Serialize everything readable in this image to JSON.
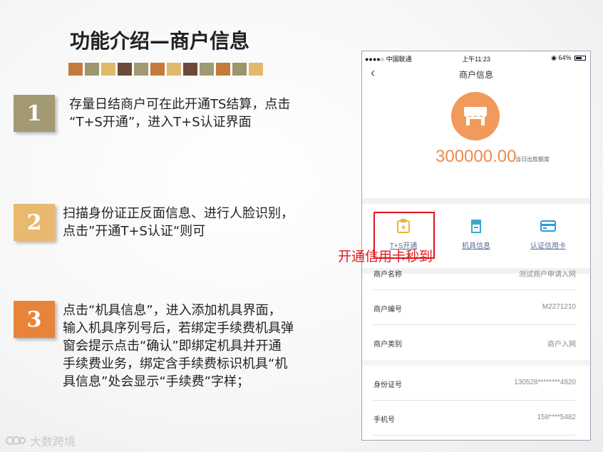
{
  "slide": {
    "title": "功能介绍—商户信息",
    "swatch_colors": [
      "#c47a3a",
      "#9c9570",
      "#e0b96d",
      "#6b4a3a",
      "#a09a72",
      "#c47a3a",
      "#e0b96d",
      "#6b4a3a",
      "#a09a72",
      "#c47a3a",
      "#9c9570",
      "#e0b96d"
    ]
  },
  "steps": [
    {
      "number": "1",
      "color": "#a39a74",
      "lines": [
        "存量日结商户可在此开通TS结算，点击",
        "“T+S开通”，进入T+S认证界面"
      ]
    },
    {
      "number": "2",
      "color": "#e8b96e",
      "lines": [
        "扫描身份证正反面信息、进行人脸识别，",
        "点击”开通T+S认证“则可"
      ]
    },
    {
      "number": "3",
      "color": "#e8843a",
      "lines": [
        "点击“机具信息”，进入添加机具界面，",
        "输入机具序列号后，若绑定手续费机具弹",
        "窗会提示点击“确认”即绑定机具并开通",
        "手续费业务，绑定含手续费标识机具“机",
        "具信息”处会显示“手续费”字样；"
      ]
    }
  ],
  "phone": {
    "status": {
      "carrier": "●●●●○ 中国联通",
      "time": "上午11:23",
      "battery": "64%"
    },
    "nav_title": "商户信息",
    "amount": "300000.00",
    "amount_label": "当日出款额度",
    "actions": [
      {
        "label": "T+S开通",
        "icon": "ts-open-icon",
        "color": "#f2b32c"
      },
      {
        "label": "机具信息",
        "icon": "device-icon",
        "color": "#3aa9c9"
      },
      {
        "label": "认证信用卡",
        "icon": "credit-card-icon",
        "color": "#2f9bd6"
      }
    ],
    "info_rows": [
      {
        "key": "商户名称",
        "value": "测试商户申请入网"
      },
      {
        "key": "商户编号",
        "value": "M2271210"
      },
      {
        "key": "商户类别",
        "value": "商户入网"
      },
      {
        "key": "身份证号",
        "value": "130528********4820"
      },
      {
        "key": "手机号",
        "value": "158****5482"
      }
    ]
  },
  "annotation": "开通信用卡秒到",
  "watermark": "大数跨境"
}
